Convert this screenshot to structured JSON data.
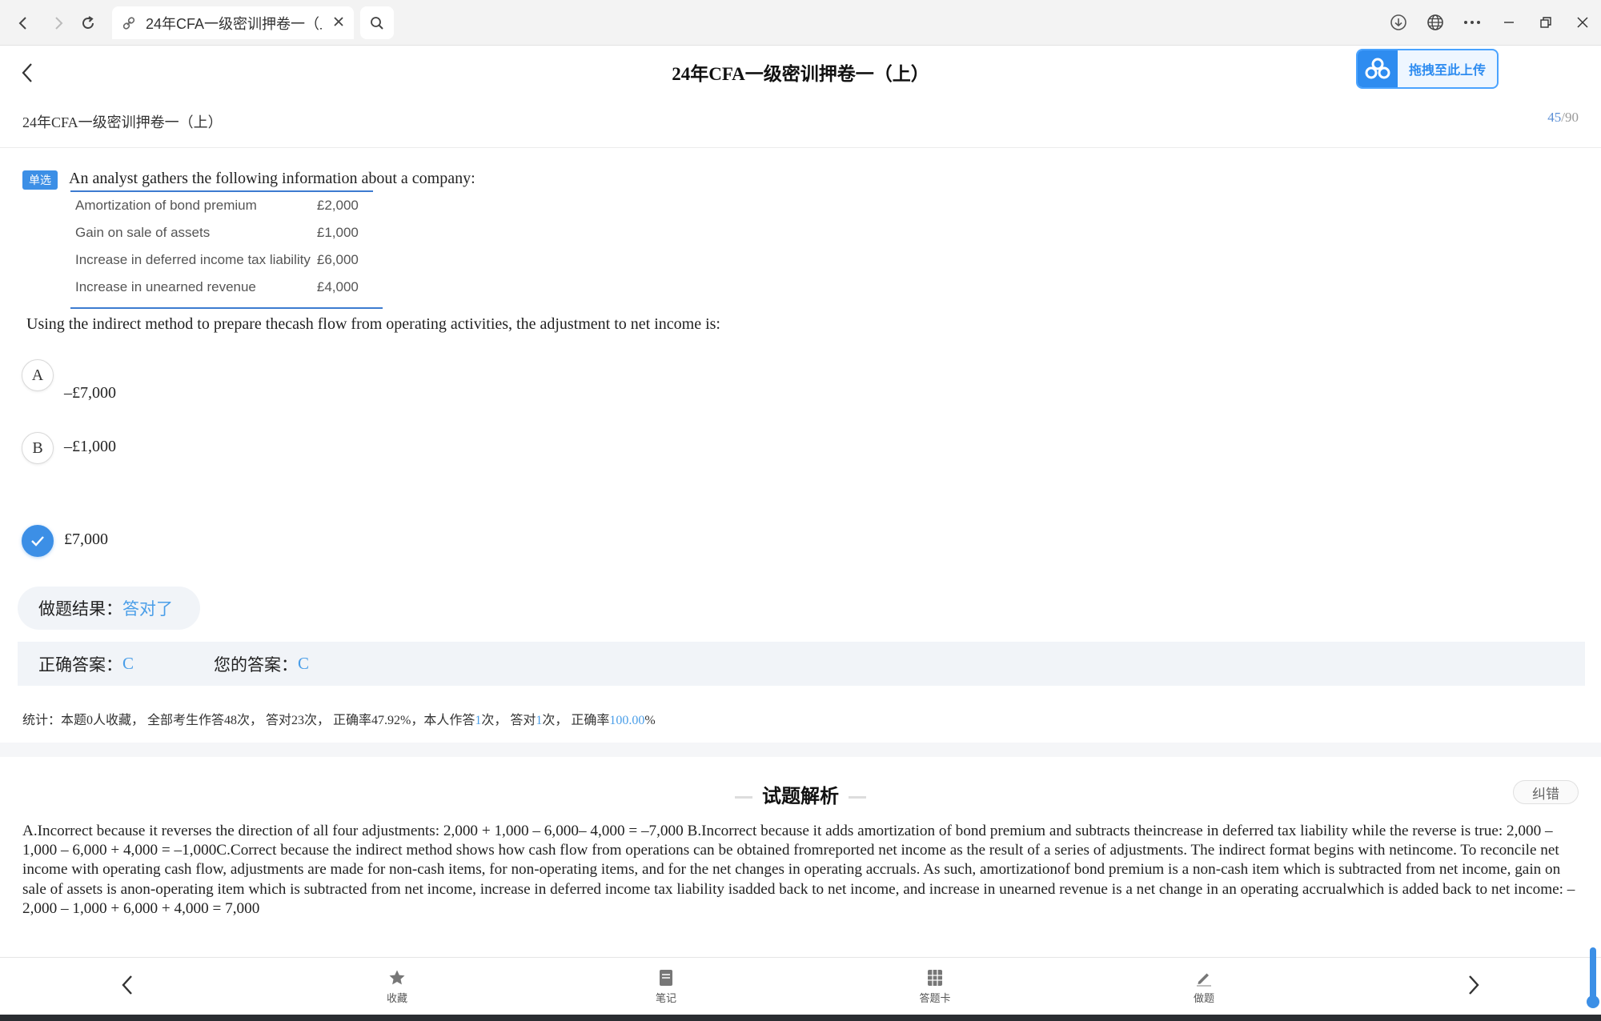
{
  "browser": {
    "tab_title": "24年CFA一级密训押卷一（上）"
  },
  "header": {
    "title": "24年CFA一级密训押卷一（上）",
    "upload_label": "拖拽至此上传",
    "subtitle": "24年CFA一级密训押卷一（上）",
    "progress_current": "45",
    "progress_total": "/90"
  },
  "question": {
    "type_tag": "单选",
    "intro": "An analyst gathers the following information about a company:",
    "table": [
      {
        "item": "Amortization of bond premium",
        "amount": "£2,000"
      },
      {
        "item": "Gain on sale of assets",
        "amount": "£1,000"
      },
      {
        "item": "Increase in deferred income tax liability",
        "amount": "£6,000"
      },
      {
        "item": "Increase in unearned revenue",
        "amount": "£4,000"
      }
    ],
    "stem": "Using the indirect method to prepare thecash flow from operating activities, the adjustment to net income is:",
    "options": [
      {
        "letter": "A",
        "text": "–£7,000"
      },
      {
        "letter": "B",
        "text": "–£1,000"
      },
      {
        "letter": "C",
        "text": "£7,000"
      }
    ]
  },
  "result": {
    "label": "做题结果：",
    "value": "答对了",
    "correct_label": "正确答案：",
    "correct_value": "C",
    "your_label": "您的答案：",
    "your_value": "C"
  },
  "stats": {
    "prefix": "统计：本题0人收藏， 全部考生作答48次， 答对23次， 正确率47.92%，本人作答",
    "my_attempts": "1",
    "mid1": "次， 答对",
    "my_correct": "1",
    "mid2": "次， 正确率",
    "my_rate": "100.00",
    "suffix": "%"
  },
  "analysis": {
    "title": "试题解析",
    "report_label": "纠错",
    "body": "A.Incorrect because it reverses the direction of all four adjustments: 2,000 + 1,000 – 6,000– 4,000 = –7,000 B.Incorrect because it adds amortization of bond premium and subtracts theincrease in deferred tax liability while the reverse is true: 2,000 – 1,000 – 6,000 + 4,000 = –1,000C.Correct because the indirect method shows how cash flow from operations can be obtained fromreported net income as the result of a series of adjustments. The indirect format begins with netincome. To reconcile net income with operating cash flow, adjustments are made for non-cash items, for non-operating items, and for the net changes in operating accruals. As such, amortizationof bond premium is a non-cash item which is subtracted from net income, gain on sale of assets is anon-operating item which is subtracted from net income, increase in deferred income tax liability isadded back to net income, and increase in unearned revenue is a net change in an operating accrualwhich is added back to net income: –2,000 – 1,000 + 6,000 + 4,000 = 7,000"
  },
  "bottom_nav": {
    "favorite": "收藏",
    "notes": "笔记",
    "answer_card": "答题卡",
    "practice": "做题"
  },
  "colors": {
    "accent": "#3c8fe6",
    "correct_text": "#4a9ee8"
  }
}
